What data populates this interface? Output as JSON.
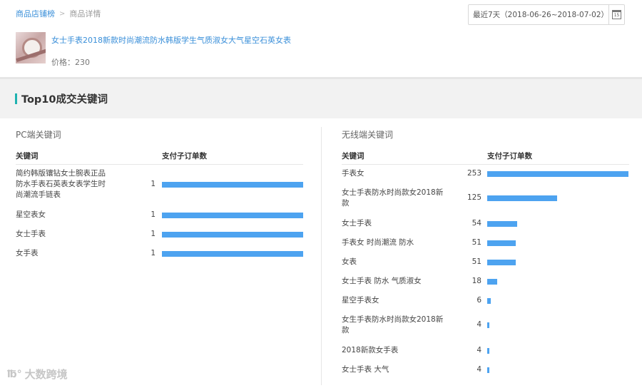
{
  "breadcrumb": {
    "items": [
      {
        "label": "商品店铺榜"
      },
      {
        "label": "商品详情"
      }
    ],
    "separator": ">"
  },
  "date_range": {
    "label": "最近7天（2018-06-26~2018-07-02）",
    "calendar_icon_text": "15"
  },
  "product": {
    "title": "女士手表2018新款时尚潮流防水韩版学生气质淑女大气星空石英女表",
    "price_label": "价格：",
    "price_value": "230"
  },
  "section": {
    "title": "Top10成交关键词"
  },
  "pc_panel": {
    "title": "PC端关键词",
    "col_keyword": "关键词",
    "col_orders": "支付子订单数",
    "rows": [
      {
        "keyword": "简约韩版镶钻女士腕表正品防水手表石英表女表学生时尚潮流手链表",
        "orders": 1
      },
      {
        "keyword": "星空表女",
        "orders": 1
      },
      {
        "keyword": "女士手表",
        "orders": 1
      },
      {
        "keyword": "女手表",
        "orders": 1
      }
    ]
  },
  "mobile_panel": {
    "title": "无线端关键词",
    "col_keyword": "关键词",
    "col_orders": "支付子订单数",
    "rows": [
      {
        "keyword": "手表女",
        "orders": 253
      },
      {
        "keyword": "女士手表防水时尚款女2018新款",
        "orders": 125
      },
      {
        "keyword": "女士手表",
        "orders": 54
      },
      {
        "keyword": "手表女 时尚潮流 防水",
        "orders": 51
      },
      {
        "keyword": "女表",
        "orders": 51
      },
      {
        "keyword": "女士手表 防水 气质淑女",
        "orders": 18
      },
      {
        "keyword": "星空手表女",
        "orders": 6
      },
      {
        "keyword": "女生手表防水时尚款女2018新款",
        "orders": 4
      },
      {
        "keyword": "2018新款女手表",
        "orders": 4
      },
      {
        "keyword": "女士手表 大气",
        "orders": 4
      }
    ]
  },
  "watermark": {
    "text": "大数跨境"
  },
  "colors": {
    "link": "#3a8fd9",
    "bar": "#4da3f0",
    "accent": "#1fb2b0"
  }
}
